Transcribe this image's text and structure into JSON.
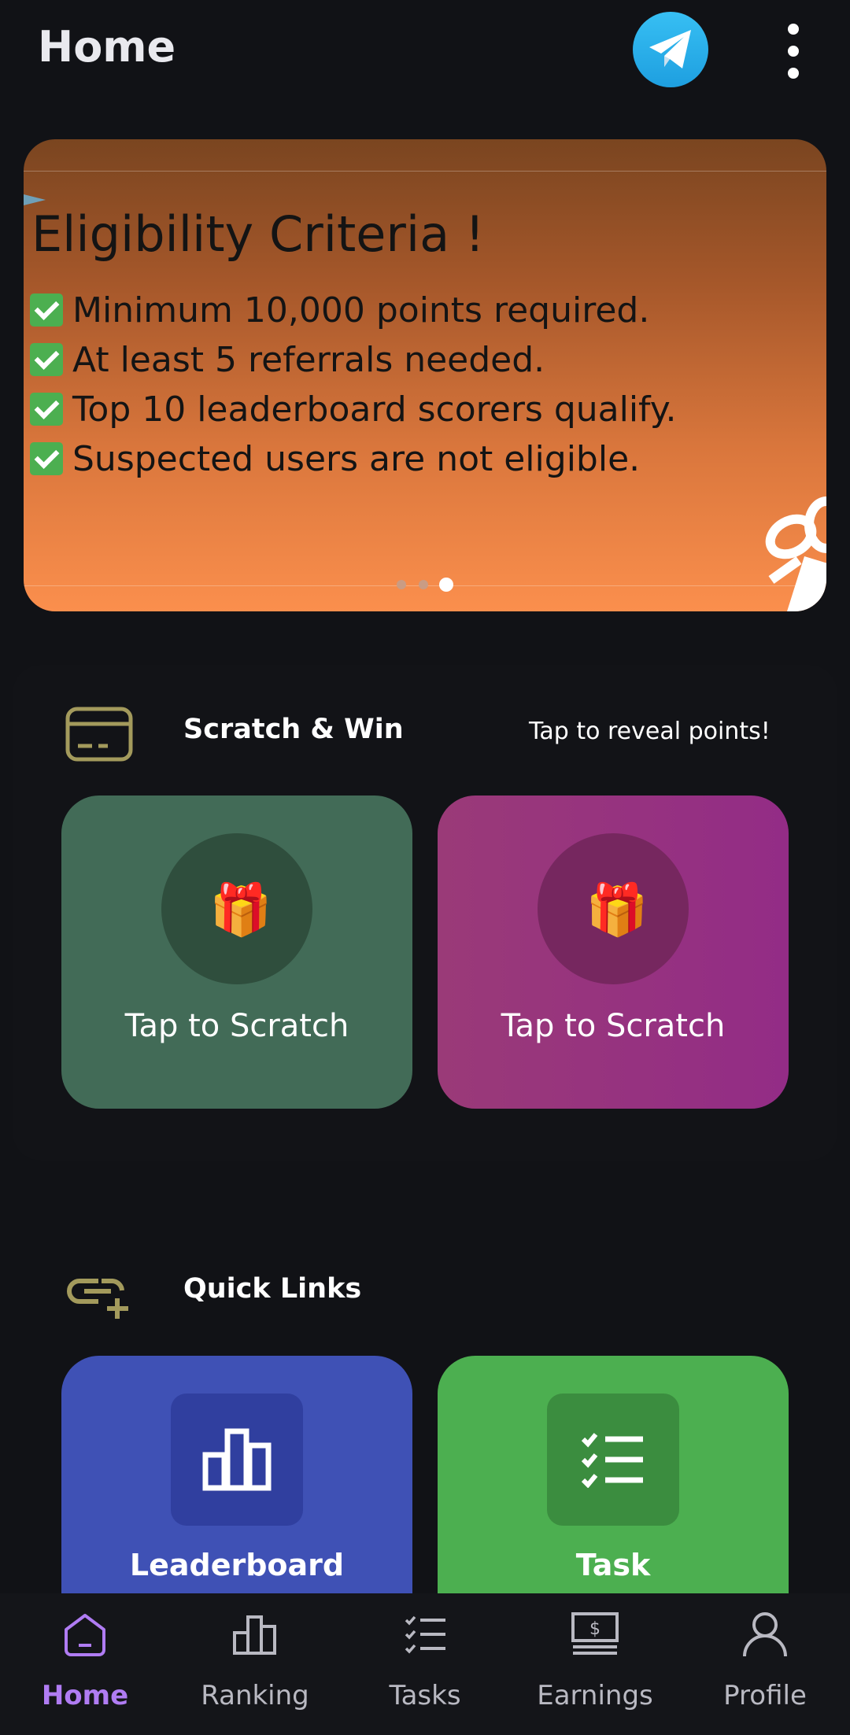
{
  "appbar": {
    "title": "Home"
  },
  "banner": {
    "title": "Eligibility Criteria !",
    "criteria": [
      "Minimum 10,000 points required.",
      "At least 5 referrals needed.",
      "Top 10 leaderboard scorers qualify.",
      "Suspected users are not eligible."
    ],
    "active_slide": 3,
    "slide_count": 3
  },
  "scratch": {
    "title": "Scratch & Win",
    "subtitle": "Tap to reveal points!",
    "cards": [
      {
        "label": "Tap to Scratch",
        "color": "#426b57"
      },
      {
        "label": "Tap to Scratch",
        "color": "#932c86"
      }
    ]
  },
  "quick_links": {
    "title": "Quick Links",
    "items": [
      {
        "label": "Leaderboard",
        "color": "#3f51b5",
        "icon": "bar-chart-icon"
      },
      {
        "label": "Task",
        "color": "#4caf50",
        "icon": "checklist-icon"
      }
    ]
  },
  "nav": {
    "items": [
      {
        "label": "Home",
        "icon": "home-icon",
        "active": true
      },
      {
        "label": "Ranking",
        "icon": "ranking-icon",
        "active": false
      },
      {
        "label": "Tasks",
        "icon": "tasks-icon",
        "active": false
      },
      {
        "label": "Earnings",
        "icon": "earnings-icon",
        "active": false
      },
      {
        "label": "Profile",
        "icon": "profile-icon",
        "active": false
      }
    ]
  },
  "colors": {
    "accent": "#b07cf3",
    "section_icon": "#a39a5c",
    "background": "#111216"
  }
}
